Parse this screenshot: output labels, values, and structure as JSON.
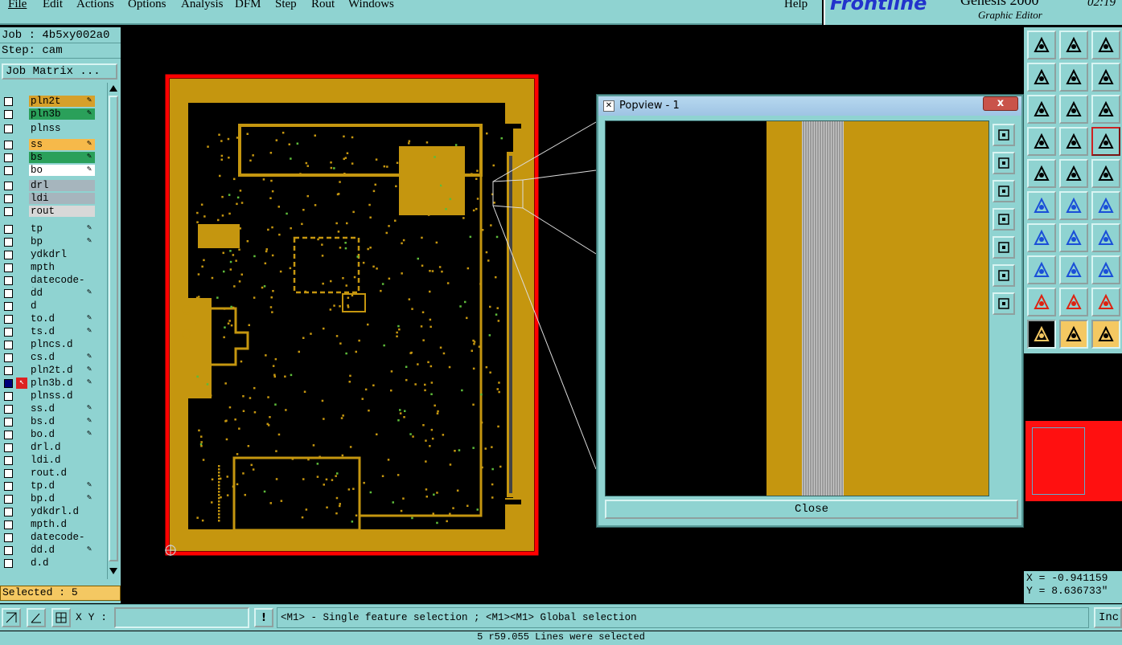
{
  "menu": [
    "File",
    "Edit",
    "Actions",
    "Options",
    "Analysis",
    "DFM",
    "Step",
    "Rout",
    "Windows",
    "Help"
  ],
  "brand": {
    "name": "Frontline",
    "product": "Genesis 2000",
    "subtitle": "Graphic Editor",
    "clock": "02:19"
  },
  "job": {
    "job_label": "Job : 4b5xy002a0",
    "step_label": "Step: cam",
    "matrix_button": "Job Matrix ..."
  },
  "layers": [
    {
      "name": "pln2t",
      "color": "#d6a02a",
      "edit": true
    },
    {
      "name": "pln3b",
      "color": "#2aa05a",
      "edit": true
    },
    {
      "name": "plnss",
      "color": "#8fd3d1",
      "edit": false
    },
    {
      "name": "ss",
      "color": "#f6b94a",
      "edit": true
    },
    {
      "name": "bs",
      "color": "#2aa05a",
      "edit": true
    },
    {
      "name": "bo",
      "color": "#ffffff",
      "edit": true
    },
    {
      "name": "drl",
      "color": "#a6b5bd",
      "edit": false
    },
    {
      "name": "ldi",
      "color": "#a6b5bd",
      "edit": false
    },
    {
      "name": "rout",
      "color": "#d8d8d8",
      "edit": false
    },
    {
      "name": "tp",
      "color": "#8fd3d1",
      "edit": true
    },
    {
      "name": "bp",
      "color": "#8fd3d1",
      "edit": true
    },
    {
      "name": "ydkdrl",
      "color": "#8fd3d1",
      "edit": false
    },
    {
      "name": "mpth",
      "color": "#8fd3d1",
      "edit": false
    },
    {
      "name": "datecode-to",
      "color": "#8fd3d1",
      "edit": false
    },
    {
      "name": "dd",
      "color": "#8fd3d1",
      "edit": true
    },
    {
      "name": "d",
      "color": "#8fd3d1",
      "edit": false
    },
    {
      "name": "to.d",
      "color": "#8fd3d1",
      "edit": true
    },
    {
      "name": "ts.d",
      "color": "#8fd3d1",
      "edit": true
    },
    {
      "name": "plncs.d",
      "color": "#8fd3d1",
      "edit": false
    },
    {
      "name": "cs.d",
      "color": "#8fd3d1",
      "edit": true
    },
    {
      "name": "pln2t.d",
      "color": "#8fd3d1",
      "edit": true
    },
    {
      "name": "pln3b.d",
      "color": "#8fd3d1",
      "edit": true,
      "work": true
    },
    {
      "name": "plnss.d",
      "color": "#8fd3d1",
      "edit": false
    },
    {
      "name": "ss.d",
      "color": "#8fd3d1",
      "edit": true
    },
    {
      "name": "bs.d",
      "color": "#8fd3d1",
      "edit": true
    },
    {
      "name": "bo.d",
      "color": "#8fd3d1",
      "edit": true
    },
    {
      "name": "drl.d",
      "color": "#8fd3d1",
      "edit": false
    },
    {
      "name": "ldi.d",
      "color": "#8fd3d1",
      "edit": false
    },
    {
      "name": "rout.d",
      "color": "#8fd3d1",
      "edit": false
    },
    {
      "name": "tp.d",
      "color": "#8fd3d1",
      "edit": true
    },
    {
      "name": "bp.d",
      "color": "#8fd3d1",
      "edit": true
    },
    {
      "name": "ydkdrl.d",
      "color": "#8fd3d1",
      "edit": false
    },
    {
      "name": "mpth.d",
      "color": "#8fd3d1",
      "edit": false
    },
    {
      "name": "datecode-to",
      "color": "#8fd3d1",
      "edit": false
    },
    {
      "name": "dd.d",
      "color": "#8fd3d1",
      "edit": true
    },
    {
      "name": "d.d",
      "color": "#8fd3d1",
      "edit": false
    }
  ],
  "selected_label": "Selected : 5",
  "popview": {
    "title": "Popview - 1",
    "close_label": "Close",
    "x_label": "x"
  },
  "bottom": {
    "xy_label": "X Y :",
    "xy_value": "",
    "excl_label": "!",
    "hint": "<M1> - Single feature selection ; <M1><M1> Global selection",
    "inc_label": "Inc"
  },
  "status_message": "5 r59.055 Lines were selected",
  "coords": {
    "x": "X = -0.941159",
    "y": "Y = 8.636733\""
  },
  "colors": {
    "panel": "#8fd3d1",
    "board": "#c5960f",
    "outline": "#ff0000",
    "highlight": "#f4c862"
  }
}
